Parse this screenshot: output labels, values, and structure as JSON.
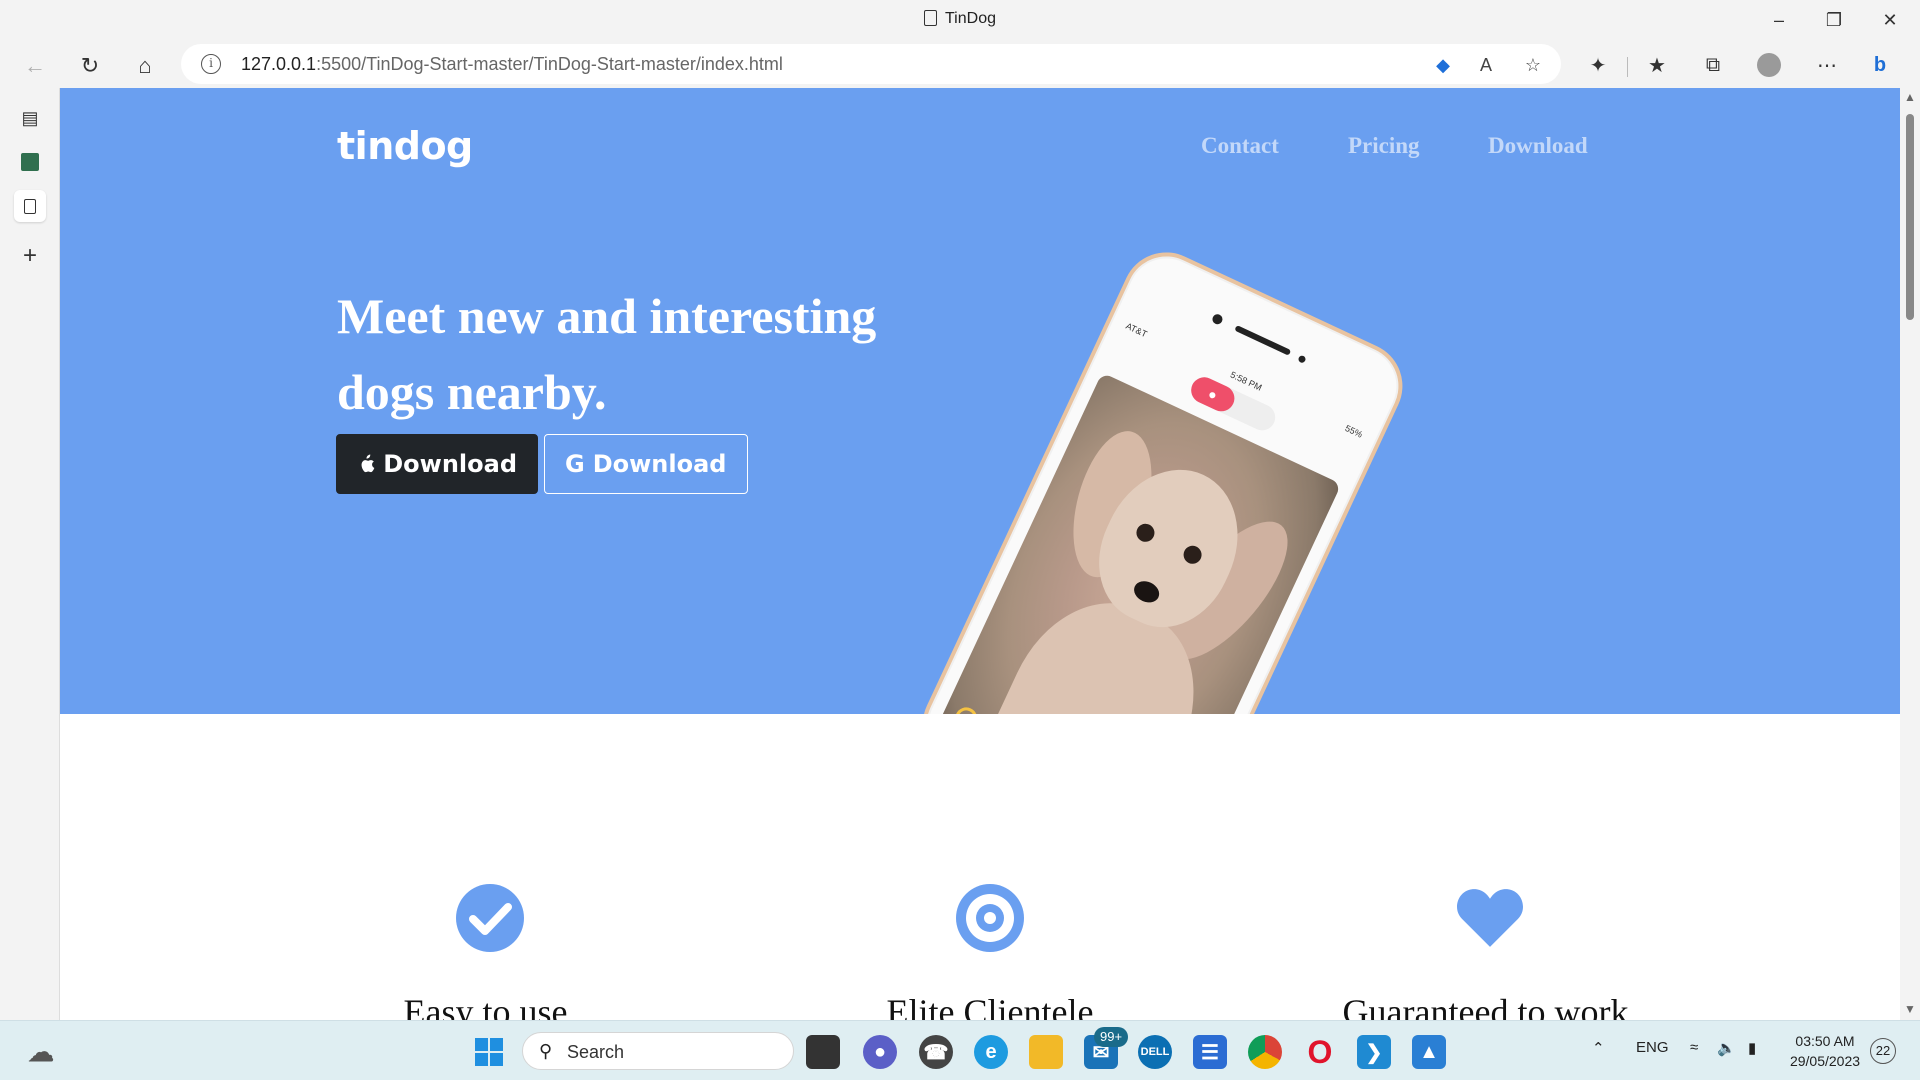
{
  "window": {
    "tab_title": "TinDog"
  },
  "addressbar": {
    "url_host": "127.0.0.1",
    "url_rest": ":5500/TinDog-Start-master/TinDog-Start-master/index.html"
  },
  "page": {
    "brand": "tindog",
    "nav": [
      "Contact",
      "Pricing",
      "Download"
    ],
    "headline_line1": "Meet new and interesting",
    "headline_line2": "dogs nearby.",
    "button_apple": "Download",
    "button_google": "Download",
    "features": [
      {
        "title": "Easy to use.",
        "icon": "check-circle-icon"
      },
      {
        "title": "Elite Clientele",
        "icon": "bullseye-icon"
      },
      {
        "title": "Guaranteed to work.",
        "icon": "heart-icon"
      }
    ],
    "phone_carrier": "AT&T",
    "phone_time": "5:58 PM",
    "phone_battery": "55%"
  },
  "taskbar": {
    "search_label": "Search",
    "mail_badge": "99+",
    "language": "ENG",
    "time": "03:50 AM",
    "date": "29/05/2023",
    "notifications": "22"
  },
  "colors": {
    "hero_bg": "#6a9ff0",
    "accent_blue": "#6a9ff0",
    "dark_button": "#212529"
  }
}
